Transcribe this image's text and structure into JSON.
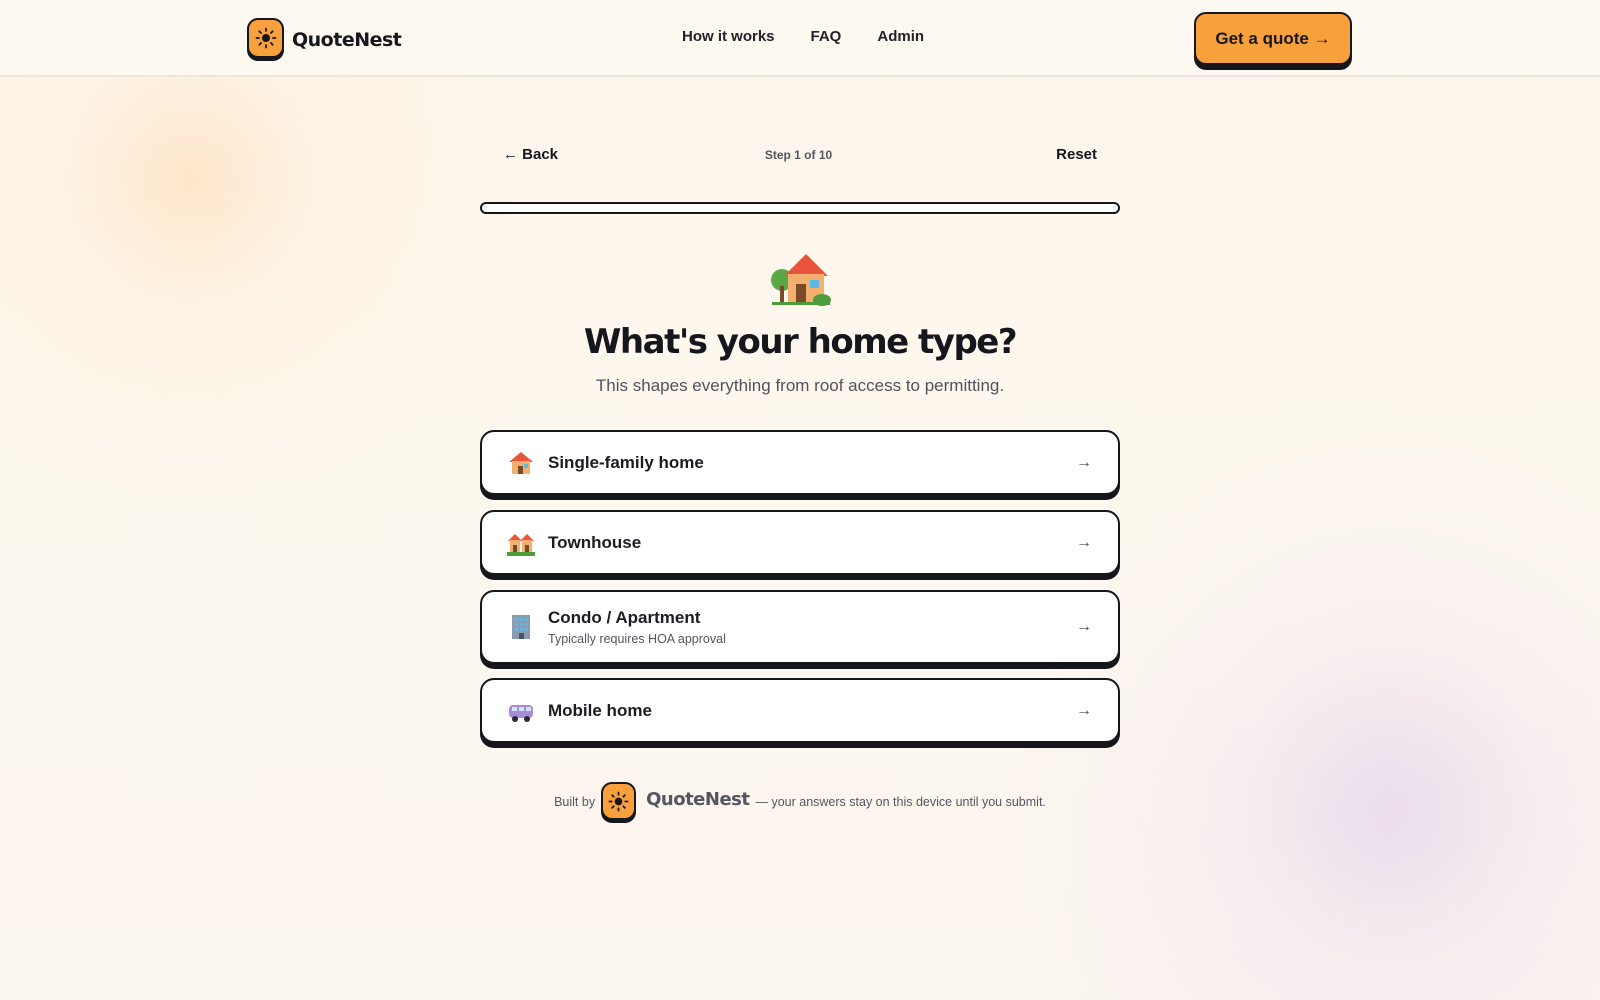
{
  "header": {
    "brand": "QuoteNest",
    "nav": [
      "How it works",
      "FAQ",
      "Admin"
    ],
    "cta": "Get a quote →"
  },
  "step": {
    "back": "← Back",
    "label": "Step 1 of 10",
    "reset": "Reset",
    "progress_fraction": 0.0
  },
  "question": {
    "icon": "house-with-garden-icon",
    "title": "What's your home type?",
    "subtitle": "This shapes everything from roof access to permitting."
  },
  "options": [
    {
      "label": "Single-family home",
      "note": "",
      "icon": "house-icon",
      "arrow": "→"
    },
    {
      "label": "Townhouse",
      "note": "",
      "icon": "townhouses-icon",
      "arrow": "→"
    },
    {
      "label": "Condo / Apartment",
      "note": "Typically requires HOA approval",
      "icon": "office-building-icon",
      "arrow": "→"
    },
    {
      "label": "Mobile home",
      "note": "",
      "icon": "minibus-icon",
      "arrow": "→"
    }
  ],
  "footer": {
    "prefix": "Built by",
    "brand": "QuoteNest",
    "suffix": "— your answers stay on this device until you submit."
  },
  "colors": {
    "accent": "#f8a03c",
    "ink": "#16161d"
  }
}
